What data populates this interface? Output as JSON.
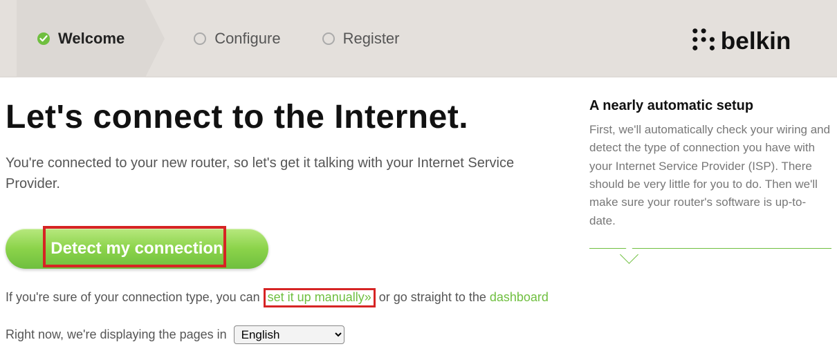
{
  "steps": {
    "welcome": "Welcome",
    "configure": "Configure",
    "register": "Register"
  },
  "brand": "belkin",
  "main": {
    "heading": "Let's connect to the Internet.",
    "intro": "You're connected to your new router, so let's get it talking with your Internet Service Provider.",
    "detect_label": "Detect my connection",
    "sub_pre": "If you're sure of your connection type, you can ",
    "manual_link": "set it up manually»",
    "sub_mid": " or go straight to the ",
    "dashboard_link": "dashboard",
    "lang_text": "Right now, we're displaying the pages in",
    "lang_value": "English"
  },
  "side": {
    "title": "A nearly automatic setup",
    "body": "First, we'll automatically check your wiring and detect the type of connection you have with your Internet Service Provider (ISP). There should be very little for you to do. Then we'll make sure your router's software is up-to-date."
  }
}
